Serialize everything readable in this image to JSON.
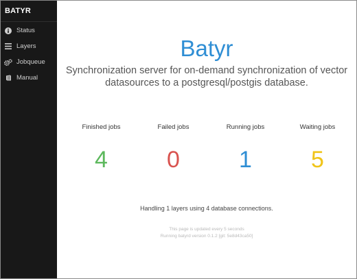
{
  "sidebar": {
    "brand": "BATYR",
    "items": [
      {
        "label": "Status",
        "icon": "info-icon"
      },
      {
        "label": "Layers",
        "icon": "list-icon"
      },
      {
        "label": "Jobqueue",
        "icon": "gears-icon"
      },
      {
        "label": "Manual",
        "icon": "book-icon"
      }
    ]
  },
  "main": {
    "title": "Batyr",
    "subtitle": "Synchronization server for on-demand synchronization of vector datasources to a postgresql/postgis database.",
    "stats": [
      {
        "label": "Finished jobs",
        "value": "4",
        "color": "#5cb85c"
      },
      {
        "label": "Failed jobs",
        "value": "0",
        "color": "#d9534f"
      },
      {
        "label": "Running jobs",
        "value": "1",
        "color": "#2f8ed4"
      },
      {
        "label": "Waiting jobs",
        "value": "5",
        "color": "#f0c419"
      }
    ],
    "handling": "Handling 1 layers using 4 database connections.",
    "footer_update": "This page is updated every 5 seconds",
    "footer_version": "Running batyrd version 0.1.2 [git: 5e8d43ca50]"
  }
}
